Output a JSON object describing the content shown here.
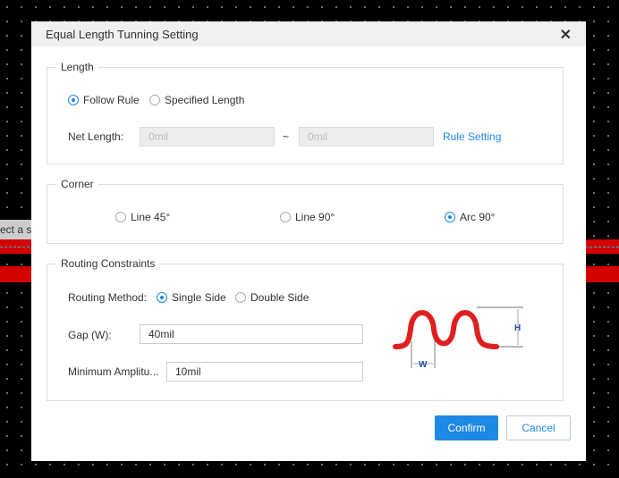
{
  "background": {
    "canvas_hint_text": "ect a st",
    "trace_color": "#d40000"
  },
  "dialog": {
    "title": "Equal Length Tunning Setting",
    "close_icon": "close-icon"
  },
  "length": {
    "legend": "Length",
    "options": [
      {
        "label": "Follow Rule",
        "selected": true
      },
      {
        "label": "Specified Length",
        "selected": false
      }
    ],
    "net_length_label": "Net Length:",
    "min_placeholder": "0mil",
    "separator": "~",
    "max_placeholder": "0mil",
    "rule_setting_link": "Rule Setting"
  },
  "corner": {
    "legend": "Corner",
    "options": [
      {
        "label": "Line 45°",
        "selected": false
      },
      {
        "label": "Line 90°",
        "selected": false
      },
      {
        "label": "Arc 90°",
        "selected": true
      }
    ]
  },
  "routing": {
    "legend": "Routing Constraints",
    "method_label": "Routing Method:",
    "methods": [
      {
        "label": "Single Side",
        "selected": true
      },
      {
        "label": "Double Side",
        "selected": false
      }
    ],
    "gap_label": "Gap (W):",
    "gap_value": "40mil",
    "amp_label": "Minimum Amplitu...",
    "amp_value": "10mil",
    "diagram": {
      "h_label": "H",
      "w_label": "W"
    }
  },
  "buttons": {
    "confirm": "Confirm",
    "cancel": "Cancel"
  },
  "colors": {
    "accent": "#1e88e5",
    "diagram_trace": "#e02020",
    "diagram_label": "#1f4fa0"
  }
}
